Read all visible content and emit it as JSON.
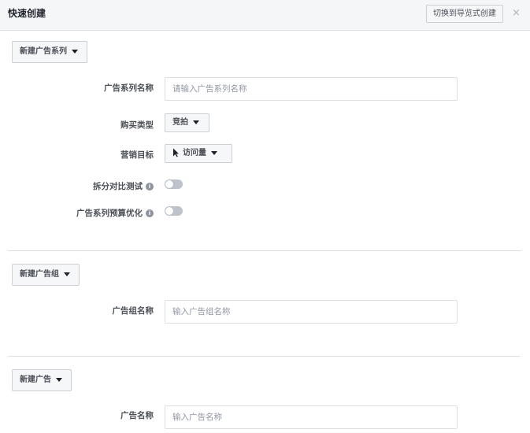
{
  "header": {
    "title": "快速创建",
    "switch_button": "切换到导览式创建",
    "close_symbol": "×"
  },
  "campaign": {
    "section_button": "新建广告系列",
    "name_label": "广告系列名称",
    "name_placeholder": "请输入广告系列名称",
    "buying_type_label": "购买类型",
    "buying_type_value": "竞拍",
    "objective_label": "营销目标",
    "objective_value": "访问量",
    "objective_icon": "cursor-icon",
    "split_test_label": "拆分对比测试",
    "split_test_on": false,
    "budget_optimization_label": "广告系列预算优化",
    "budget_optimization_on": false,
    "info_symbol": "i"
  },
  "adset": {
    "section_button": "新建广告组",
    "name_label": "广告组名称",
    "name_placeholder": "输入广告组名称"
  },
  "ad": {
    "section_button": "新建广告",
    "name_label": "广告名称",
    "name_placeholder": "输入广告名称"
  }
}
